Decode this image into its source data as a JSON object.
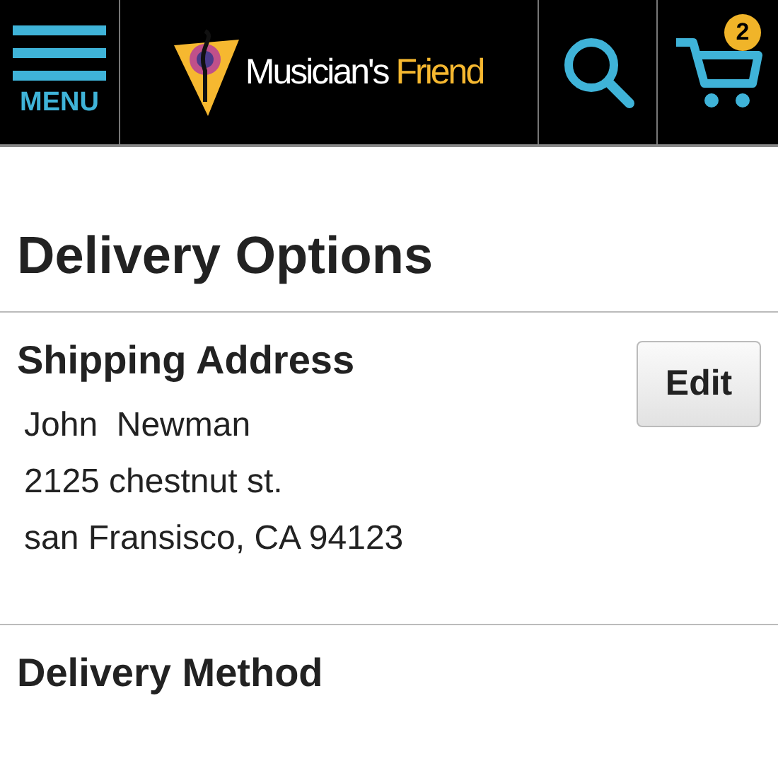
{
  "header": {
    "menu_label": "MENU",
    "logo": {
      "first": "Musician's",
      "second": "Friend"
    },
    "cart_count": "2"
  },
  "title": "Delivery Options",
  "shipping": {
    "heading": "Shipping Address",
    "edit": "Edit",
    "lines": [
      "John  Newman",
      "2125 chestnut st.",
      "san Fransisco, CA 94123"
    ]
  },
  "delivery": {
    "heading": "Delivery Method"
  }
}
